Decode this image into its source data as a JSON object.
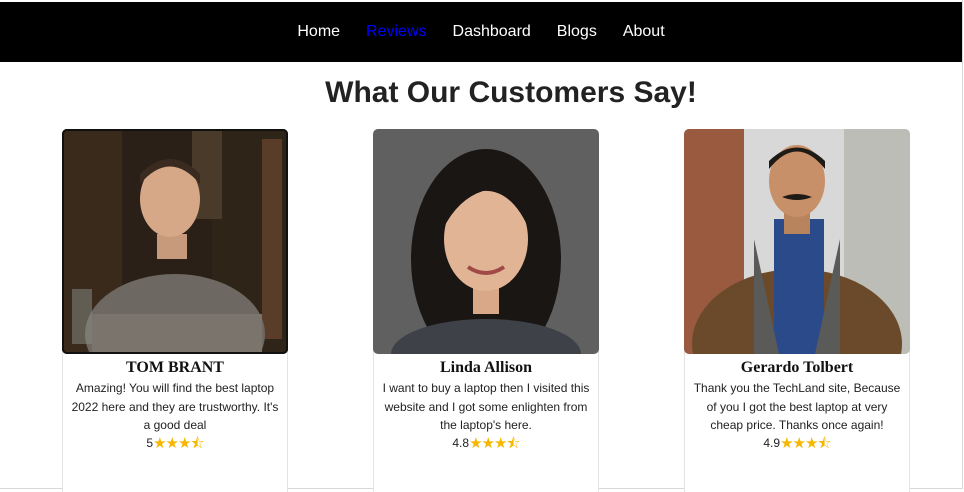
{
  "nav": {
    "items": [
      {
        "label": "Home",
        "active": false
      },
      {
        "label": "Reviews",
        "active": true
      },
      {
        "label": "Dashboard",
        "active": false
      },
      {
        "label": "Blogs",
        "active": false
      },
      {
        "label": "About",
        "active": false
      }
    ],
    "active_color": "#0000ff"
  },
  "page": {
    "title": "What Our Customers Say!"
  },
  "reviews": [
    {
      "name": "TOM BRANT",
      "text": "Amazing! You will find the best laptop 2022 here and they are trustworthy. It's a good deal",
      "rating": "5",
      "stars": "★★★⯪"
    },
    {
      "name": "Linda Allison",
      "text": "I want to buy a laptop then I visited this website and I got some enlighten from the laptop's here.",
      "rating": "4.8",
      "stars": "★★★⯪"
    },
    {
      "name": "Gerardo Tolbert",
      "text": "Thank you the TechLand site, Because of you I got the best laptop at very cheap price. Thanks once again!",
      "rating": "4.9",
      "stars": "★★★⯪"
    }
  ],
  "colors": {
    "navbar": "#000000",
    "star": "#f5b700"
  }
}
